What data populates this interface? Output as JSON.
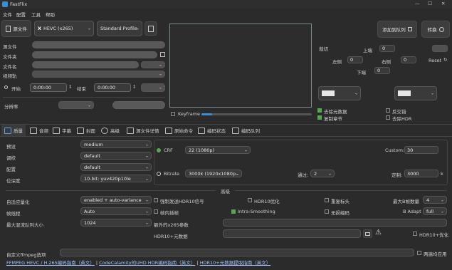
{
  "window": {
    "title": "FastFlix",
    "min": "—",
    "max": "☐",
    "close": "✕"
  },
  "menu": [
    "文件",
    "配置",
    "工具",
    "帮助"
  ],
  "toolbar": {
    "source_button": "源文件",
    "encoder": "HEVC (x265)",
    "profile": "Standard Profile",
    "add_queue": "添加到队列",
    "convert": "转换"
  },
  "left": {
    "source_label": "源文件",
    "folder_label": "文件夹",
    "filename_label": "文件名",
    "video_track_label": "视频轨",
    "start_label": "开始",
    "start_time": "0:00:00",
    "end_label": "结束",
    "end_time": "0:00:00",
    "resolution_label": "分辨率"
  },
  "preview": {
    "keyframe_label": "Keyframe"
  },
  "crop": {
    "title": "裁切",
    "top": "上端",
    "top_val": "0",
    "left": "左侧",
    "left_val": "0",
    "right": "右侧",
    "right_val": "0",
    "bottom": "下端",
    "bottom_val": "0",
    "reset": "Reset"
  },
  "options": {
    "remove_metadata": "去除元数据",
    "copy_chapters": "复制章节",
    "hflip": "反交错",
    "remove_hdr": "去除HDR"
  },
  "tabs": [
    "质量",
    "音频",
    "字幕",
    "封面",
    "高级",
    "源文件详情",
    "原始命令",
    "编码状态",
    "编码队列"
  ],
  "settings": {
    "preset_label": "预设",
    "preset": "medium",
    "tune_label": "调校",
    "tune": "default",
    "profile_label": "配置",
    "profile": "default",
    "bitdepth_label": "位深度",
    "bitdepth": "10-bit: yuv420p10le",
    "crf_label": "CRF",
    "crf": "22 (1080p)",
    "custom_label": "Custom:",
    "custom": "30",
    "bitrate_label": "Bitrate",
    "bitrate": "3000k   (1920x1080p...",
    "passes_label": "通过:",
    "passes": "2",
    "custom_bitrate_label": "定制:",
    "custom_bitrate": "3000",
    "k_label": "k"
  },
  "advanced": {
    "title": "高级",
    "aq_label": "自适应量化",
    "aq": "enabled + auto-variance",
    "force_hdr": "强制发送HDR10信号",
    "hdr10_opt": "HDR10优化",
    "repeat_headers": "重复标头",
    "max_b_label": "最大B帧数量",
    "max_b": "4",
    "frame_threads_label": "帧线程",
    "frame_threads": "Auto",
    "frame_threads_chk": "帧内插帧",
    "intra_smoothing": "Intra-Smoothing",
    "lossless": "无损编码",
    "badapt_label": "B Adapt",
    "badapt": "full",
    "max_mux_label": "最大混流队列大小",
    "max_mux": "1024",
    "extra_x265_label": "额外的x265参数",
    "hdr10_meta_label": "HDR10+元数据",
    "hdr10plus_opt": "HDR10+优化",
    "custom_ffmpeg_label": "自定义ffmpeg选项",
    "two_pass": "两遍均应用"
  },
  "links": [
    "FFMPEG HEVC / H.265编码指南（英文）",
    "CodeCalamity的UHD HDR编码指南（英文）",
    "HDR10+元数据提取指南（英文）"
  ]
}
